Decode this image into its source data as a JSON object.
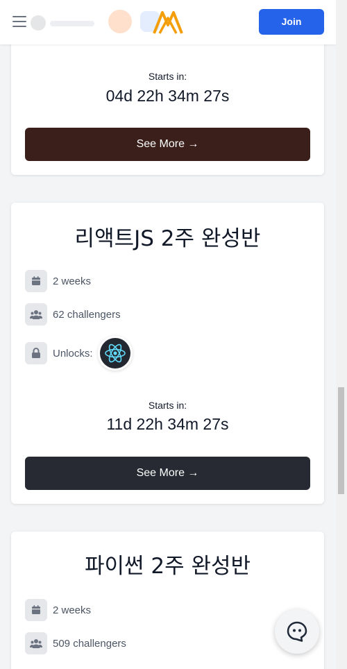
{
  "header": {
    "join_label": "Join"
  },
  "cards": [
    {
      "starts_label": "Starts in:",
      "countdown": "04d 22h 34m 27s",
      "button_label": "See More →",
      "button_color": "#3a1f1b"
    },
    {
      "title": "리액트JS 2주 완성반",
      "duration": "2 weeks",
      "challengers": "62 challengers",
      "unlocks_label": "Unlocks:",
      "unlock_icon": "react-icon",
      "starts_label": "Starts in:",
      "countdown": "11d 22h 34m 27s",
      "button_label": "See More →",
      "button_color": "#272a33"
    },
    {
      "title": "파이썬 2주 완성반",
      "duration": "2 weeks",
      "challengers": "509 challengers"
    }
  ],
  "colors": {
    "accent": "#2563eb",
    "logo": "#f59e0b"
  }
}
